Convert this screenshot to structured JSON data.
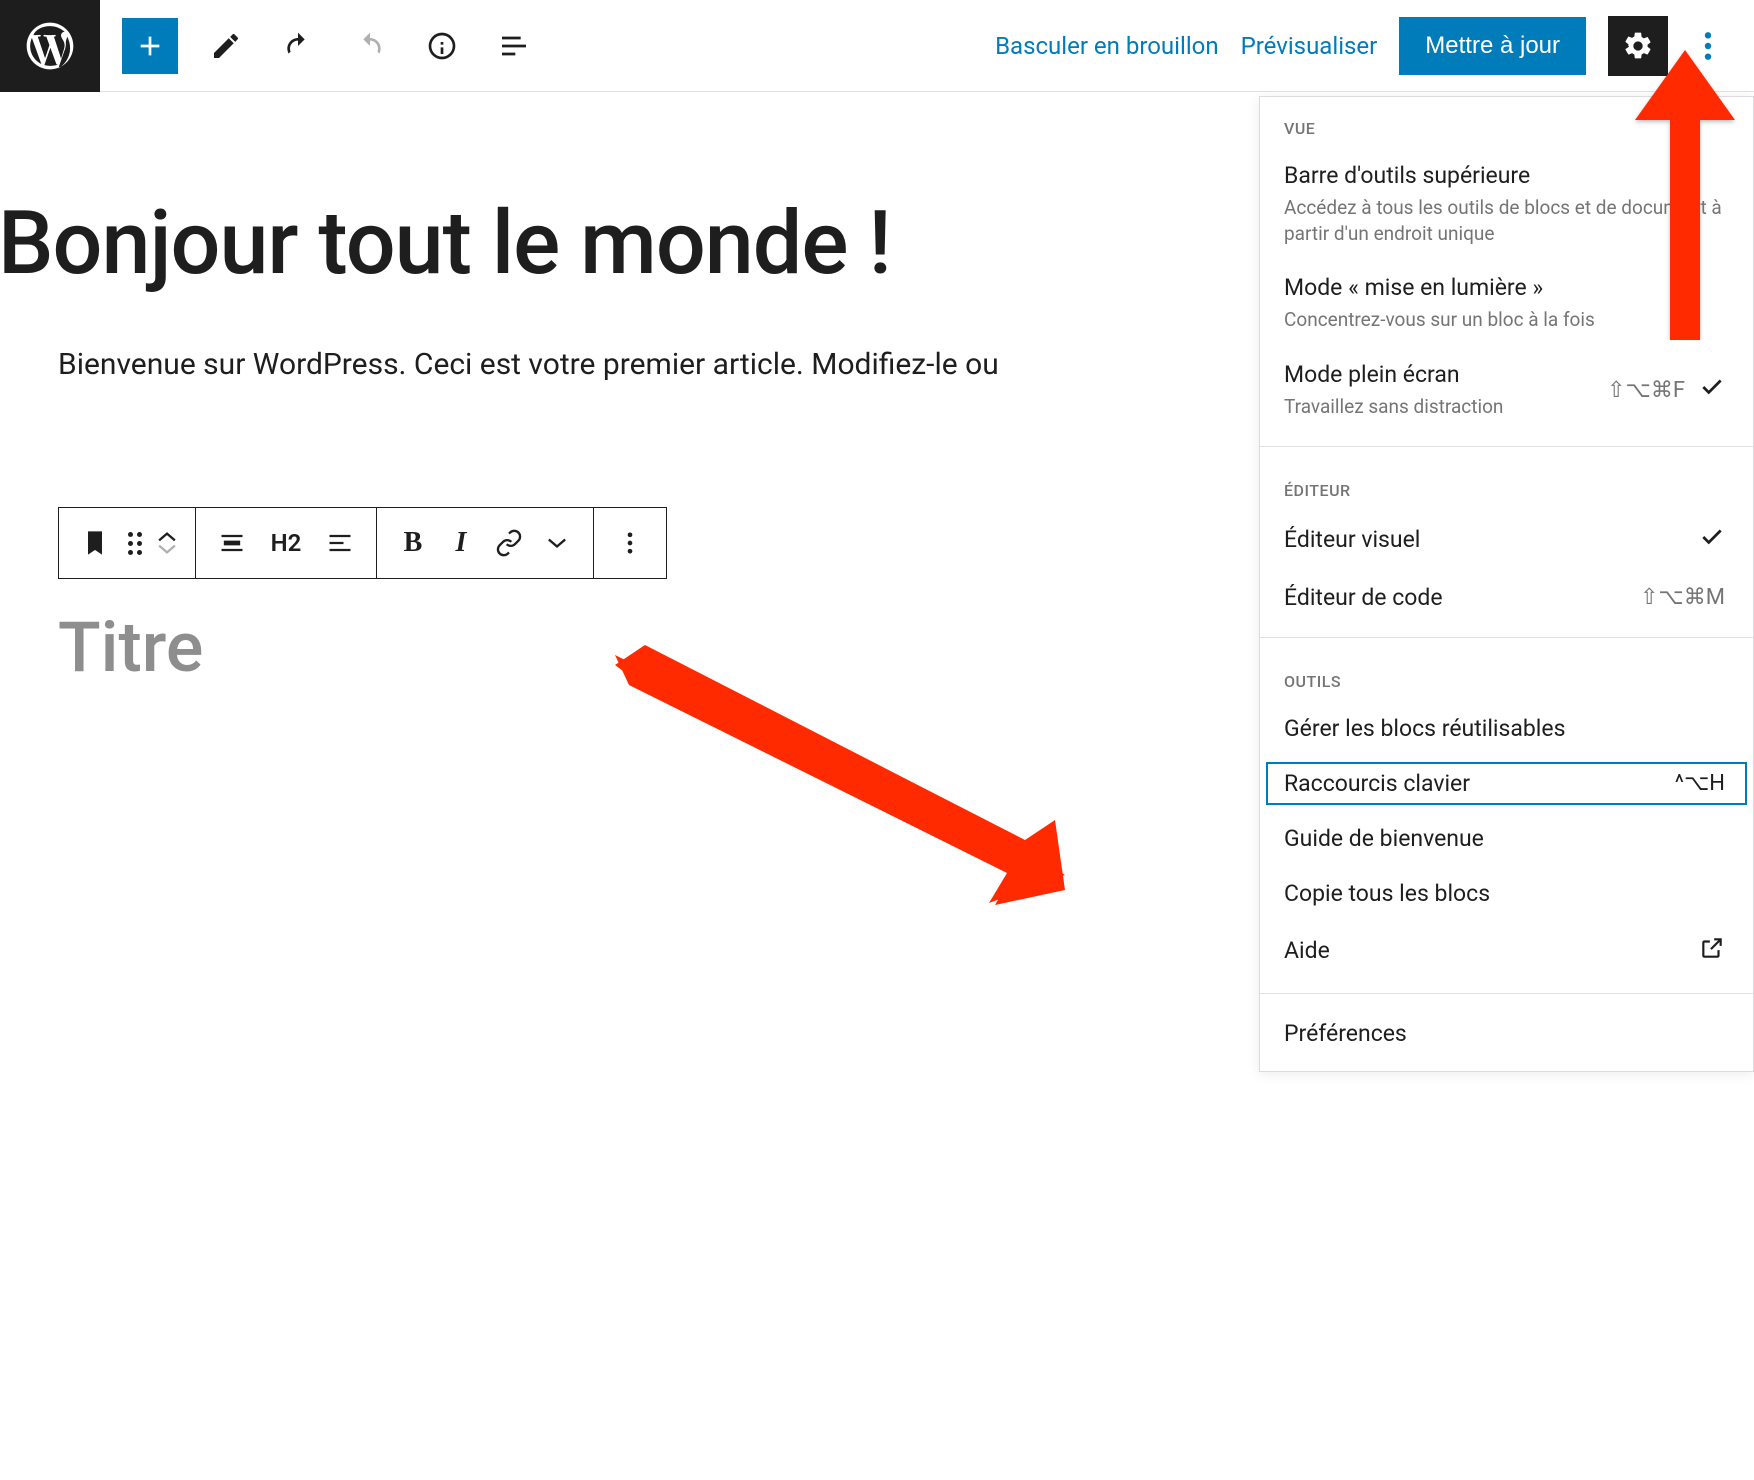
{
  "topbar": {
    "draft_link": "Basculer en brouillon",
    "preview_link": "Prévisualiser",
    "update_button": "Mettre à jour"
  },
  "editor": {
    "post_title": "Bonjour tout le monde !",
    "intro_paragraph": "Bienvenue sur WordPress. Ceci est votre premier article. Modifiez-le ou",
    "heading_placeholder": "Titre",
    "block_toolbar_heading_level": "H2"
  },
  "dropdown": {
    "section_view": "VUE",
    "section_editor": "ÉDITEUR",
    "section_tools": "OUTILS",
    "items": {
      "top_toolbar": {
        "title": "Barre d'outils supérieure",
        "desc": "Accédez à tous les outils de blocs et de document à partir d'un endroit unique"
      },
      "spotlight": {
        "title": "Mode « mise en lumière »",
        "desc": "Concentrez-vous sur un bloc à la fois"
      },
      "fullscreen": {
        "title": "Mode plein écran",
        "desc": "Travaillez sans distraction",
        "shortcut": "⇧⌥⌘F"
      },
      "visual_editor": {
        "title": "Éditeur visuel"
      },
      "code_editor": {
        "title": "Éditeur de code",
        "shortcut": "⇧⌥⌘M"
      },
      "manage_reusable": {
        "title": "Gérer les blocs réutilisables"
      },
      "shortcuts": {
        "title": "Raccourcis clavier",
        "shortcut": "^⌥H"
      },
      "welcome_guide": {
        "title": "Guide de bienvenue"
      },
      "copy_all": {
        "title": "Copie tous les blocs"
      },
      "help": {
        "title": "Aide"
      },
      "preferences": {
        "title": "Préférences"
      }
    }
  }
}
